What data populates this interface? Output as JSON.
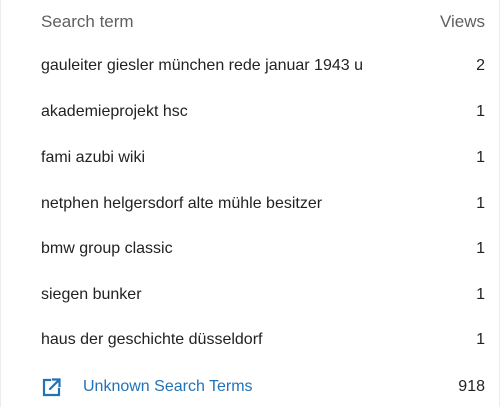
{
  "header": {
    "term_label": "Search term",
    "views_label": "Views"
  },
  "rows": [
    {
      "term": "gauleiter giesler münchen rede januar 1943 u",
      "views": "2"
    },
    {
      "term": "akademieprojekt hsc",
      "views": "1"
    },
    {
      "term": "fami azubi wiki",
      "views": "1"
    },
    {
      "term": "netphen helgersdorf alte mühle besitzer",
      "views": "1"
    },
    {
      "term": "bmw group classic",
      "views": "1"
    },
    {
      "term": "siegen bunker",
      "views": "1"
    },
    {
      "term": "haus der geschichte düsseldorf",
      "views": "1"
    }
  ],
  "footer": {
    "link_label": "Unknown Search Terms",
    "link_icon": "external-link-icon",
    "count": "918"
  },
  "colors": {
    "accent": "#2272b9",
    "text": "#222222",
    "header_text": "#5f5f5f"
  }
}
